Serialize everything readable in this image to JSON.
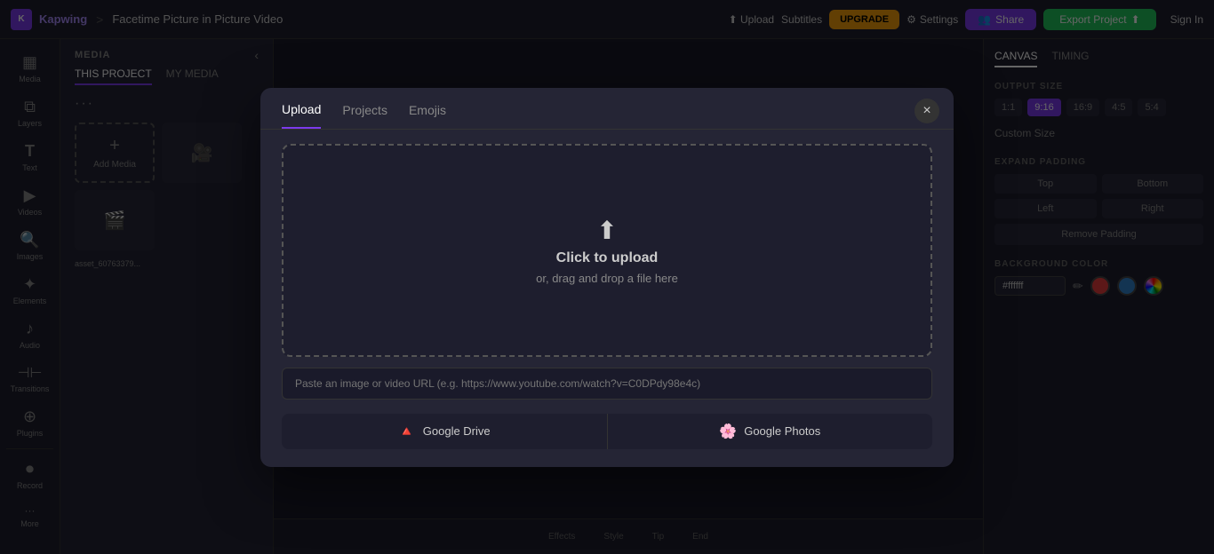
{
  "app": {
    "brand": "Kapwing",
    "separator": ">",
    "project_name": "Facetime Picture in Picture Video"
  },
  "nav": {
    "upload_label": "Upload",
    "subtitles_label": "Subtitles",
    "upgrade_label": "UPGRADE",
    "settings_label": "Settings",
    "share_label": "Share",
    "export_label": "Export Project",
    "signin_label": "Sign In"
  },
  "left_sidebar": {
    "items": [
      {
        "id": "media",
        "icon": "▦",
        "label": "Media"
      },
      {
        "id": "layers",
        "icon": "⧉",
        "label": "Layers"
      },
      {
        "id": "text",
        "icon": "T",
        "label": "Text"
      },
      {
        "id": "videos",
        "icon": "▶",
        "label": "Videos"
      },
      {
        "id": "images",
        "icon": "🔍",
        "label": "Images"
      },
      {
        "id": "elements",
        "icon": "✦",
        "label": "Elements"
      },
      {
        "id": "audio",
        "icon": "♪",
        "label": "Audio"
      },
      {
        "id": "transitions",
        "icon": "⊣",
        "label": "Transitions"
      },
      {
        "id": "plugins",
        "icon": "⊕",
        "label": "Plugins"
      },
      {
        "id": "record",
        "icon": "",
        "label": "Record"
      },
      {
        "id": "more",
        "icon": "···",
        "label": "More"
      }
    ]
  },
  "media_panel": {
    "title": "MEDIA",
    "tabs": [
      {
        "id": "this-project",
        "label": "THIS PROJECT",
        "active": true
      },
      {
        "id": "my-media",
        "label": "MY MEDIA",
        "active": false
      }
    ],
    "add_media_label": "Add Media",
    "filename": "asset_60763379..."
  },
  "right_panel": {
    "tabs": [
      {
        "id": "canvas",
        "label": "CANVAS",
        "active": true
      },
      {
        "id": "timing",
        "label": "TIMING",
        "active": false
      }
    ],
    "output_size": {
      "label": "OUTPUT SIZE",
      "options": [
        {
          "id": "1-1",
          "label": "1:1"
        },
        {
          "id": "9-16",
          "label": "9:16",
          "active": true
        },
        {
          "id": "16-9",
          "label": "16:9"
        },
        {
          "id": "4-5",
          "label": "4:5"
        },
        {
          "id": "5-4",
          "label": "5:4"
        }
      ],
      "custom_size_label": "Custom Size"
    },
    "expand_padding": {
      "label": "EXPAND PADDING",
      "buttons": [
        {
          "id": "top",
          "label": "Top"
        },
        {
          "id": "bottom",
          "label": "Bottom"
        },
        {
          "id": "left",
          "label": "Left"
        },
        {
          "id": "right",
          "label": "Right"
        }
      ],
      "remove_label": "Remove Padding"
    },
    "background_color": {
      "label": "BACKGROUND COLOR",
      "value": "#ffffff",
      "swatches": [
        {
          "id": "red",
          "color": "#e53e3e"
        },
        {
          "id": "blue",
          "color": "#3182ce"
        },
        {
          "id": "rainbow",
          "color": "conic-gradient"
        }
      ]
    }
  },
  "bottom_toolbar": {
    "items": [
      {
        "id": "effects",
        "label": "Effects"
      },
      {
        "id": "style",
        "label": "Style"
      },
      {
        "id": "tip",
        "label": "Tip"
      },
      {
        "id": "end",
        "label": "End"
      }
    ]
  },
  "modal": {
    "tabs": [
      {
        "id": "upload",
        "label": "Upload",
        "active": true
      },
      {
        "id": "projects",
        "label": "Projects",
        "active": false
      },
      {
        "id": "emojis",
        "label": "Emojis",
        "active": false
      }
    ],
    "close_label": "×",
    "dropzone": {
      "icon": "⬆",
      "title": "Click to upload",
      "subtitle": "or, drag and drop a file here"
    },
    "url_placeholder": "Paste an image or video URL (e.g. https://www.youtube.com/watch?v=C0DPdy98e4c)",
    "google_drive_label": "Google Drive",
    "google_photos_label": "Google Photos"
  },
  "colors": {
    "accent_purple": "#7c3aed",
    "accent_green": "#22c55e",
    "accent_amber": "#f59e0b",
    "bg_dark": "#1e1e2e",
    "bg_darker": "#1a1a2a",
    "panel_bg": "#252535",
    "border": "#333333"
  }
}
